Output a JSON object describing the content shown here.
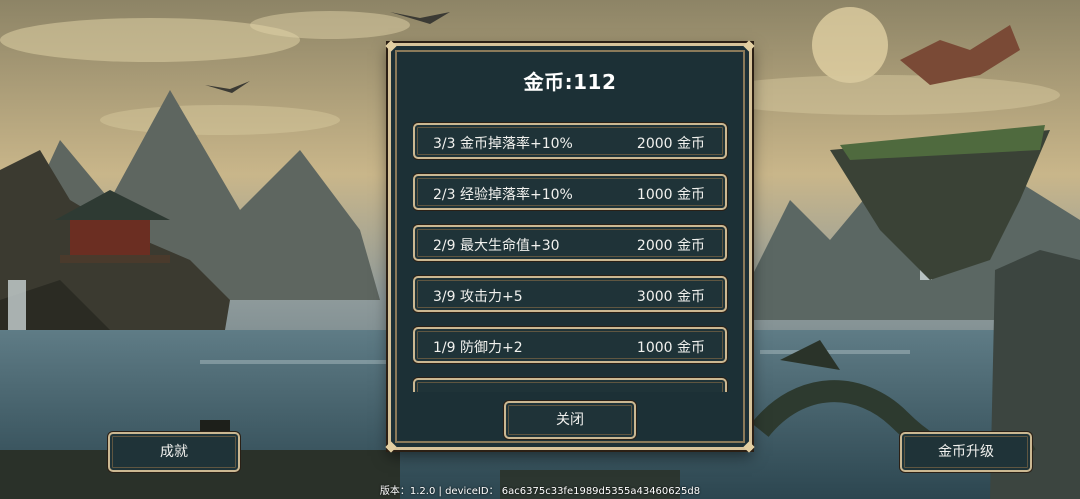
{
  "panel": {
    "title": "金币:112",
    "upgrades": [
      {
        "level": "3/3",
        "name": "金币掉落率+10%",
        "cost": "2000 金币"
      },
      {
        "level": "2/3",
        "name": "经验掉落率+10%",
        "cost": "1000 金币"
      },
      {
        "level": "2/9",
        "name": "最大生命值+30",
        "cost": "2000 金币"
      },
      {
        "level": "3/9",
        "name": "攻击力+5",
        "cost": "3000 金币"
      },
      {
        "level": "1/9",
        "name": "防御力+2",
        "cost": "1000 金币"
      }
    ],
    "close_label": "关闭"
  },
  "buttons": {
    "achievements": "成就",
    "gold_upgrade": "金币升级"
  },
  "footer": {
    "version_label": "版本：",
    "version": "1.2.0",
    "device_label": "deviceID：",
    "device_id": "6ac6375c33fe1989d5355a43460625d8"
  },
  "colors": {
    "panel_bg": "#1c3036",
    "border_gold": "#d7c39a",
    "text": "#f1f1ee"
  }
}
